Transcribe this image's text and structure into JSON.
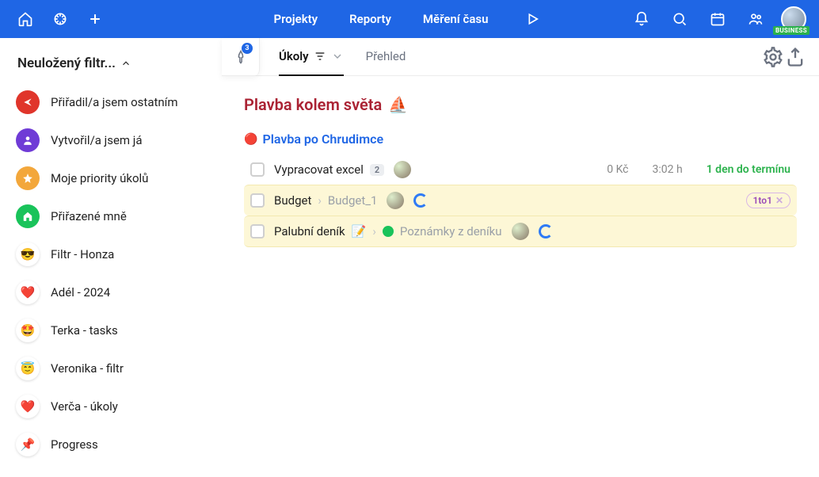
{
  "nav": {
    "links": [
      "Projekty",
      "Reporty",
      "Měření času"
    ],
    "plan_tag": "BUSINESS"
  },
  "sidebar": {
    "filter_title": "Neuložený filtr...",
    "items": [
      {
        "label": "Přiřadil/a jsem ostatním",
        "icon": "share",
        "bg": "#e0352b"
      },
      {
        "label": "Vytvořil/a jsem já",
        "icon": "person",
        "bg": "#6f3bd6"
      },
      {
        "label": "Moje priority úkolů",
        "icon": "star",
        "bg": "#f3a73b"
      },
      {
        "label": "Přiřazené mně",
        "icon": "home",
        "bg": "#19c35a"
      },
      {
        "label": "Filtr - Honza",
        "emoji": "😎"
      },
      {
        "label": "Adél - 2024",
        "emoji": "❤️"
      },
      {
        "label": "Terka - tasks",
        "emoji": "🤩"
      },
      {
        "label": "Veronika - filtr",
        "emoji": "😇"
      },
      {
        "label": "Verča - úkoly",
        "emoji": "❤️"
      },
      {
        "label": "Progress",
        "emoji": "📌"
      }
    ]
  },
  "tabs": {
    "pinned_count": "3",
    "active": "Úkoly",
    "inactive": "Přehled"
  },
  "project": {
    "title": "Plavba kolem světa",
    "emoji": "⛵",
    "phase": {
      "dot": "🔴",
      "name": "Plavba po Chrudimce"
    }
  },
  "tasks": [
    {
      "name": "Vypracovat excel",
      "count": "2",
      "money": "0 Kč",
      "time": "3:02 h",
      "due": "1 den do termínu",
      "hl": false
    },
    {
      "name": "Budget",
      "crumb": "Budget_1",
      "pill": "1to1",
      "hl": true,
      "spinner": true
    },
    {
      "name": "Palubní deník",
      "emoji": "📝",
      "status_green": true,
      "crumb": "Poznámky z deníku",
      "hl": true,
      "spinner": true
    }
  ]
}
